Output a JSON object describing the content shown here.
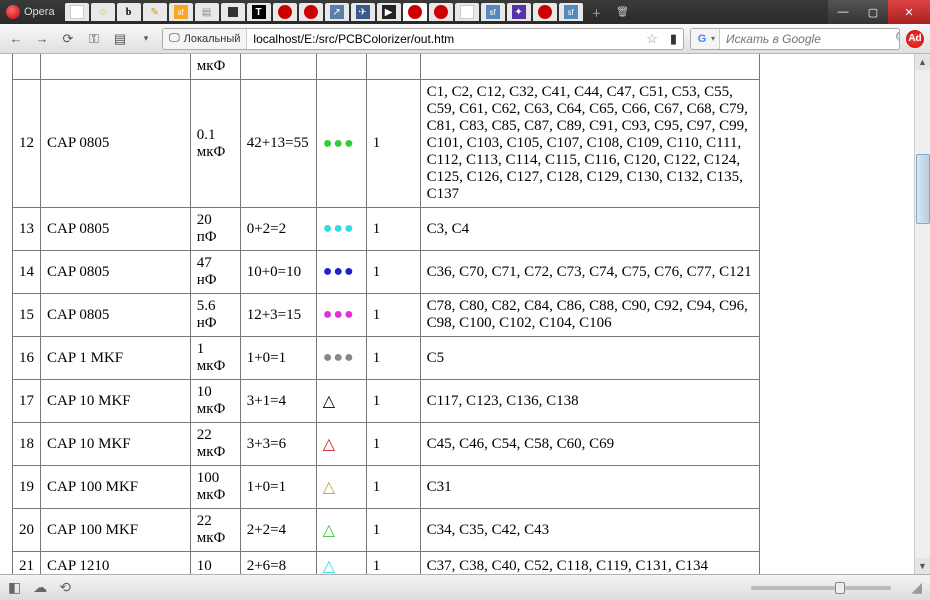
{
  "browser": {
    "name": "Opera",
    "address_label": "Локальный",
    "url": "localhost/E:/src/PCBColorizer/out.htm",
    "search_placeholder": "Искать в Google"
  },
  "partial_row_top": {
    "val": "мкФ"
  },
  "rows": [
    {
      "n": "12",
      "pkg": "CAP 0805",
      "val": "0.1 мкФ",
      "cnt": "42+13=55",
      "mark_color": "#33cc33",
      "mark_type": "dots",
      "q": "1",
      "refs": "C1, C2, C12, C32, C41, C44, C47, C51, C53, C55, C59, C61, C62, C63, C64, C65, C66, C67, C68, C79, C81, C83, C85, C87, C89, C91, C93, C95, C97, C99, C101, C103, C105, C107, C108, C109, C110, C111, C112, C113, C114, C115, C116, C120, C122, C124, C125, C126, C127, C128, C129, C130, C132, C135, C137"
    },
    {
      "n": "13",
      "pkg": "CAP 0805",
      "val": "20 пФ",
      "cnt": "0+2=2",
      "mark_color": "#33dddd",
      "mark_type": "dots",
      "q": "1",
      "refs": "C3, C4"
    },
    {
      "n": "14",
      "pkg": "CAP 0805",
      "val": "47 нФ",
      "cnt": "10+0=10",
      "mark_color": "#2222cc",
      "mark_type": "dots",
      "q": "1",
      "refs": "C36, C70, C71, C72, C73, C74, C75, C76, C77, C121"
    },
    {
      "n": "15",
      "pkg": "CAP 0805",
      "val": "5.6 нФ",
      "cnt": "12+3=15",
      "mark_color": "#dd33dd",
      "mark_type": "dots",
      "q": "1",
      "refs": "C78, C80, C82, C84, C86, C88, C90, C92, C94, C96, C98, C100, C102, C104, C106"
    },
    {
      "n": "16",
      "pkg": "CAP 1 MKF",
      "val": "1 мкФ",
      "cnt": "1+0=1",
      "mark_color": "#888888",
      "mark_type": "dots",
      "q": "1",
      "refs": "C5"
    },
    {
      "n": "17",
      "pkg": "CAP 10 MKF",
      "val": "10 мкФ",
      "cnt": "3+1=4",
      "mark_color": "#000000",
      "mark_type": "tri",
      "q": "1",
      "refs": "C117, C123, C136, C138"
    },
    {
      "n": "18",
      "pkg": "CAP 10 MKF",
      "val": "22 мкФ",
      "cnt": "3+3=6",
      "mark_color": "#cc2222",
      "mark_type": "tri",
      "q": "1",
      "refs": "C45, C46, C54, C58, C60, C69"
    },
    {
      "n": "19",
      "pkg": "CAP 100 MKF",
      "val": "100 мкФ",
      "cnt": "1+0=1",
      "mark_color": "#cc9933",
      "mark_type": "tri",
      "q": "1",
      "refs": "C31"
    },
    {
      "n": "20",
      "pkg": "CAP 100 MKF",
      "val": "22 мкФ",
      "cnt": "2+2=4",
      "mark_color": "#33cc33",
      "mark_type": "tri",
      "q": "1",
      "refs": "C34, C35, C42, C43"
    }
  ],
  "partial_row_bottom": {
    "n": "21",
    "pkg": "CAP 1210",
    "val": "10",
    "cnt": "2+6=8",
    "mark_color": "#33dddd",
    "mark_type": "tri",
    "q": "1",
    "refs": "C37, C38, C40, C52, C118, C119, C131, C134"
  }
}
